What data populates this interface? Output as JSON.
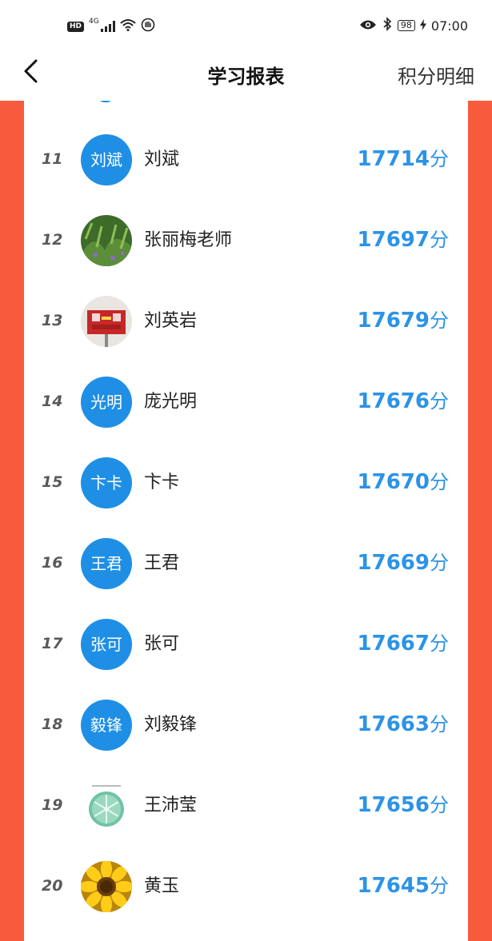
{
  "status_bar": {
    "hd": "HD",
    "network": "4G",
    "battery": "98",
    "time": "07:00"
  },
  "header": {
    "title": "学习报表",
    "right_link": "积分明细"
  },
  "rows": [
    {
      "rank": "11",
      "avatar_text": "刘斌",
      "name": "刘斌",
      "score": "17714",
      "unit": "分"
    },
    {
      "rank": "12",
      "avatar_text": "",
      "avatar_image": "plants-photo",
      "name": "张丽梅老师",
      "score": "17697",
      "unit": "分"
    },
    {
      "rank": "13",
      "avatar_text": "",
      "avatar_image": "red-sign-photo",
      "name": "刘英岩",
      "score": "17679",
      "unit": "分"
    },
    {
      "rank": "14",
      "avatar_text": "光明",
      "name": "庞光明",
      "score": "17676",
      "unit": "分"
    },
    {
      "rank": "15",
      "avatar_text": "卞卡",
      "name": "卞卡",
      "score": "17670",
      "unit": "分"
    },
    {
      "rank": "16",
      "avatar_text": "王君",
      "name": "王君",
      "score": "17669",
      "unit": "分"
    },
    {
      "rank": "17",
      "avatar_text": "张可",
      "name": "张可",
      "score": "17667",
      "unit": "分"
    },
    {
      "rank": "18",
      "avatar_text": "毅锋",
      "name": "刘毅锋",
      "score": "17663",
      "unit": "分"
    },
    {
      "rank": "19",
      "avatar_text": "",
      "avatar_image": "lime-slice-image",
      "name": "王沛莹",
      "score": "17656",
      "unit": "分"
    },
    {
      "rank": "20",
      "avatar_text": "",
      "avatar_image": "sunflower-photo",
      "name": "黄玉",
      "score": "17645",
      "unit": "分"
    }
  ],
  "colors": {
    "accent": "#f75a3d",
    "avatar_blue": "#1f8fe6",
    "score_blue": "#2c93e6"
  }
}
